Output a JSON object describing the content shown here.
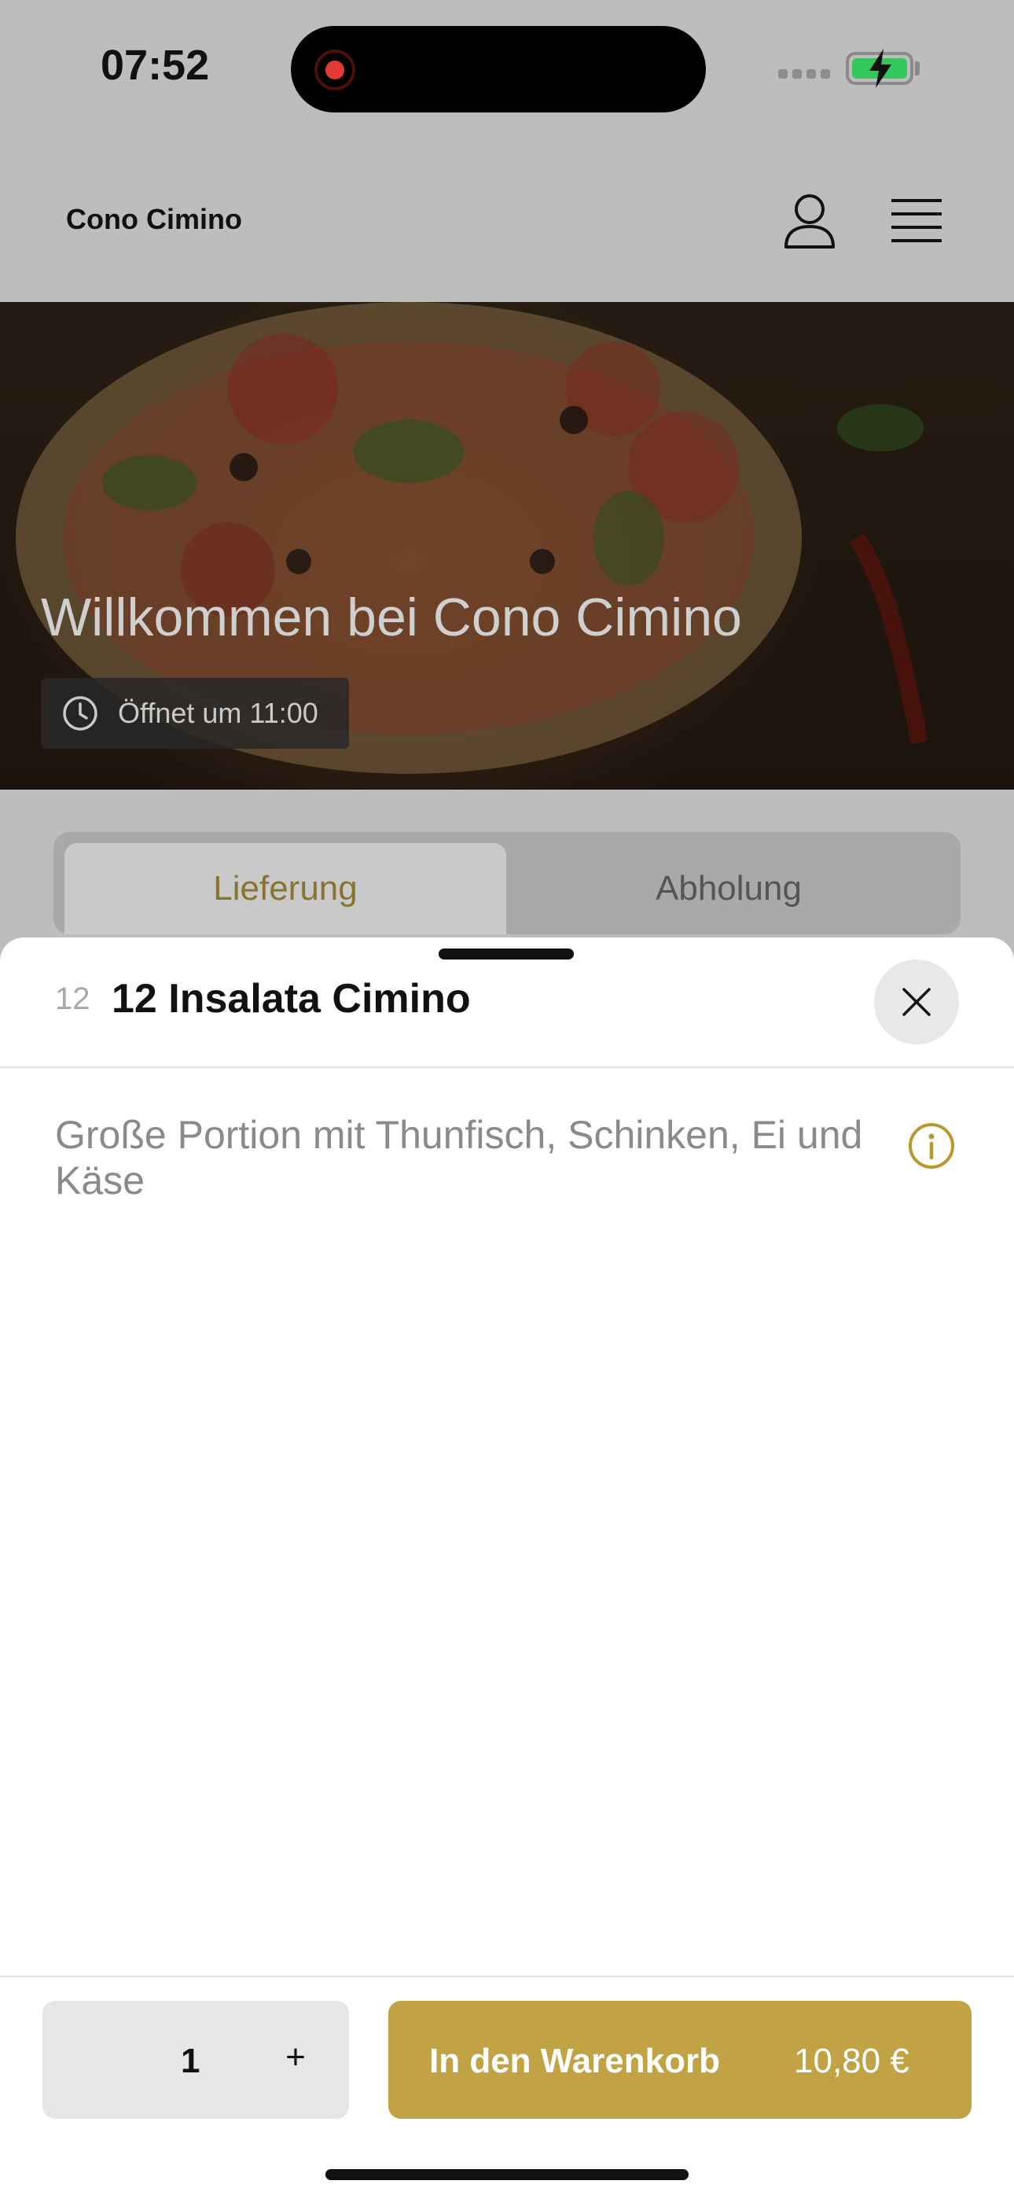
{
  "status_bar": {
    "time": "07:52"
  },
  "header": {
    "brand": "Cono Cimino"
  },
  "hero": {
    "title": "Willkommen bei Cono Cimino",
    "opening_badge": "Öffnet um 11:00"
  },
  "tabs": [
    {
      "label": "Lieferung",
      "active": true
    },
    {
      "label": "Abholung",
      "active": false
    }
  ],
  "sheet": {
    "item_number": "12",
    "item_title": "12 Insalata Cimino",
    "description": "Große Portion mit Thunfisch, Schinken, Ei und Käse"
  },
  "footer": {
    "quantity": "1",
    "plus_symbol": "+",
    "cart_label": "In den Warenkorb",
    "price": "10,80 €"
  },
  "colors": {
    "accent": "#c1a346",
    "tab_active_text": "#8a7330",
    "overlay": "#bdbdbd"
  },
  "icons": [
    "record-indicator-icon",
    "signal-icon",
    "battery-charging-icon",
    "user-icon",
    "menu-icon",
    "clock-icon",
    "close-icon",
    "info-icon"
  ]
}
